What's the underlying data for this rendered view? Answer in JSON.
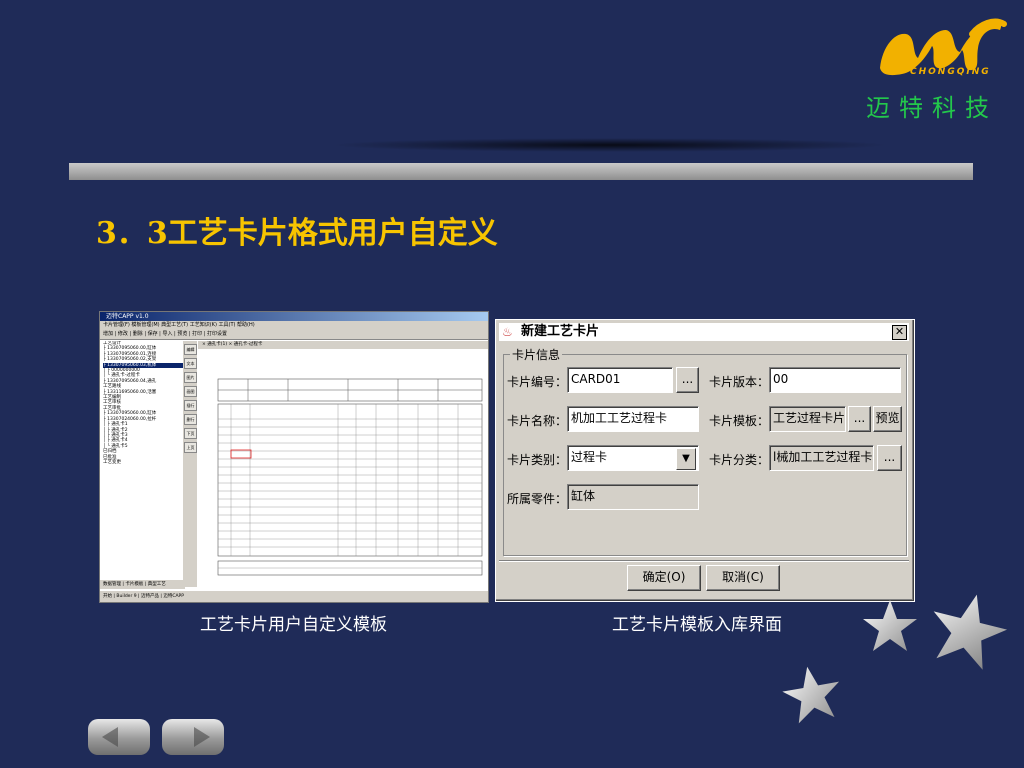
{
  "slide": {
    "title": "3．3工艺卡片格式用户自定义",
    "logo": {
      "brand_cn": "迈特科技",
      "brand_en": "CHONGQING",
      "accent": "#f2b100",
      "text_color": "#23c84b"
    },
    "background": "#1f2b58",
    "title_color": "#f7c400"
  },
  "left_screenshot": {
    "caption": "工艺卡片用户自定义模板",
    "window_title": "迈特CAPP v1.0",
    "menu": "卡片管理(F)  模板管理(M)  典型工艺(T)  工艺知识(K)  工具(T)  帮助(H)",
    "toolbar": "增加 | 修改 | 删除 | 保存 | 导入 | 预览 | 打印 | 打印设置",
    "tab_label": "× 通孔卡(1)  × 通孔卡-过程卡",
    "tree_items": [
      "工艺设计",
      "工艺路线",
      "工艺编制",
      "工艺审核",
      "工艺审批",
      "已归档",
      "已批准",
      "工艺变更"
    ],
    "side_buttons": [
      "编辑",
      "文本",
      "图片",
      "画图",
      "插行",
      "删行",
      "下页",
      "上页"
    ],
    "bottom_tabs": "数据管理 | 卡片模板 | 典型工艺",
    "taskbar": "开始 | Builder 9 | 迈特产品 | 迈特CAPP"
  },
  "dialog": {
    "title": "新建工艺卡片",
    "group_label": "卡片信息",
    "fields": {
      "card_no_label": "卡片编号：",
      "card_no_value": "CARD01",
      "card_version_label": "卡片版本：",
      "card_version_value": "00",
      "card_name_label": "卡片名称：",
      "card_name_value": "机加工工艺过程卡",
      "card_template_label": "卡片模板：",
      "card_template_value": "工艺过程卡片",
      "card_type_label": "卡片类别：",
      "card_type_value": "过程卡",
      "card_category_label": "卡片分类：",
      "card_category_value": "l械加工工艺过程卡",
      "part_label": "所属零件：",
      "part_value": "缸体"
    },
    "buttons": {
      "browse": "...",
      "preview": "预览",
      "ok": "确定(O)",
      "cancel": "取消(C)"
    },
    "caption": "工艺卡片模板入库界面"
  }
}
